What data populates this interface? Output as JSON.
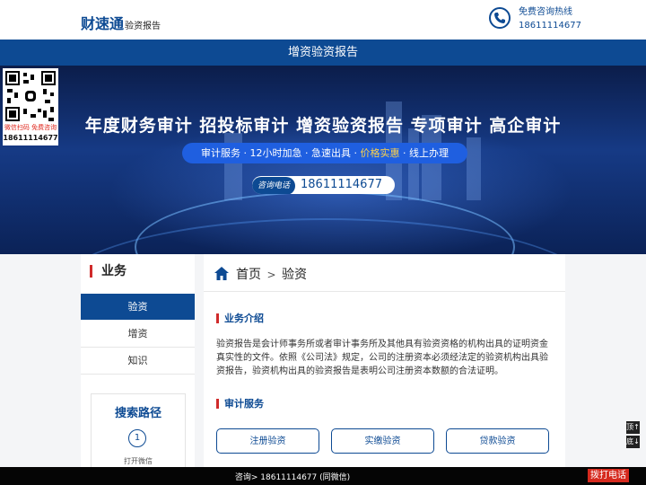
{
  "header": {
    "brand": "财速通",
    "brand_sub": "验资报告",
    "hotline_label": "免费咨询热线",
    "hotline_number": "18611114677"
  },
  "title_bar": "增资验资报告",
  "banner": {
    "headline": "年度财务审计 招投标审计 增资验资报告 专项审计 高企审计",
    "pill_parts": [
      "审计服务 · 12小时加急 · 急速出具 · ",
      "价格实惠",
      " · 线上办理"
    ],
    "tel_tag": "咨询电话",
    "tel_number": "18611114677"
  },
  "qr": {
    "caption": "微信扫码 免费咨询",
    "number": "18611114677"
  },
  "sidebar": {
    "title": "业务",
    "items": [
      {
        "label": "验资",
        "active": true
      },
      {
        "label": "增资",
        "active": false
      },
      {
        "label": "知识",
        "active": false
      }
    ],
    "search": {
      "title": "搜索路径",
      "step_number": "1",
      "step_label": "打开微信"
    }
  },
  "main": {
    "crumb_home": "首页",
    "crumb_sep": ">",
    "crumb_current": "验资",
    "intro_title": "业务介绍",
    "intro_text": "验资报告是会计师事务所或者审计事务所及其他具有验资资格的机构出具的证明资金真实性的文件。依照《公司法》规定，公司的注册资本必须经法定的验资机构出具验资报告，验资机构出具的验资报告是表明公司注册资本数额的合法证明。",
    "service_title": "审计服务",
    "services": [
      "注册验资",
      "实缴验资",
      "贷款验资"
    ]
  },
  "float": {
    "top": "顶↑",
    "bottom": "底↓"
  },
  "bottom_bar": {
    "text": "咨询> 18611114677 (同微信)",
    "call_button": "拨打电话"
  },
  "colors": {
    "primary": "#0d4a93",
    "accent": "#d02b2b",
    "call": "#d62a1e"
  }
}
